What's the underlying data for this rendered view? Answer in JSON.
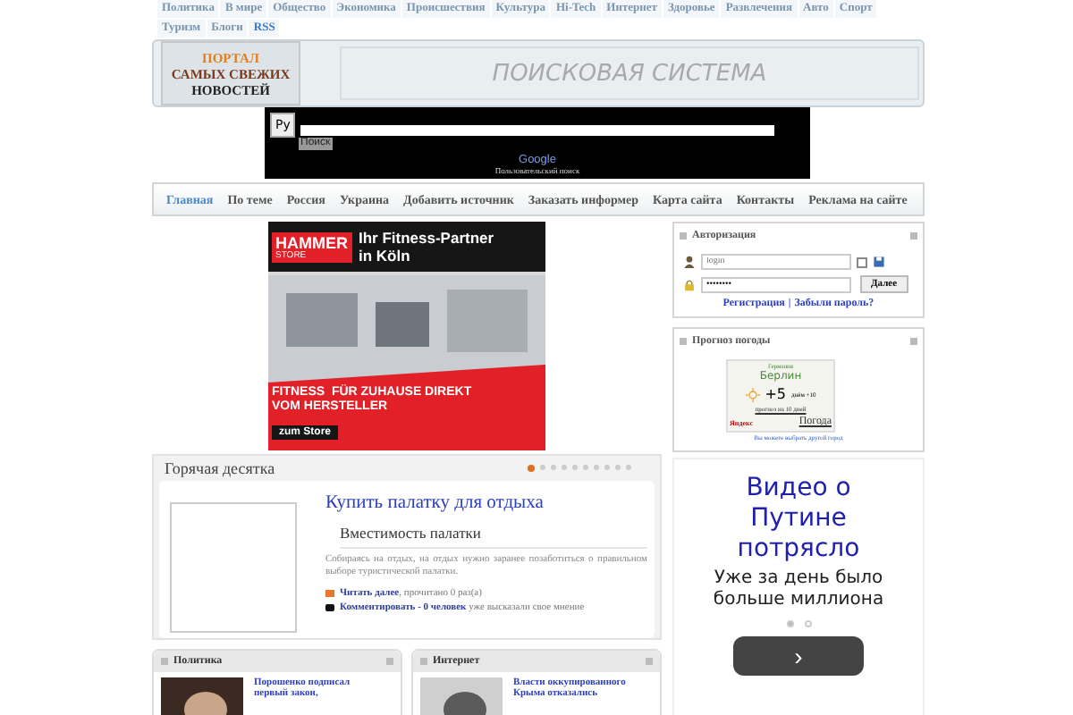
{
  "top_nav": [
    {
      "label": "Политика",
      "kind": "plain"
    },
    {
      "label": "В мире",
      "kind": "plain"
    },
    {
      "label": "Общество",
      "kind": "plain"
    },
    {
      "label": "Экономика",
      "kind": "plain"
    },
    {
      "label": "Происшествия",
      "kind": "plain"
    },
    {
      "label": "Культура",
      "kind": "plain"
    },
    {
      "label": "Hi-Tech",
      "kind": "plain"
    },
    {
      "label": "Интернет",
      "kind": "plain"
    },
    {
      "label": "Здоровье",
      "kind": "plain"
    },
    {
      "label": "Развлечения",
      "kind": "plain"
    },
    {
      "label": "Авто",
      "kind": "plain"
    },
    {
      "label": "Спорт",
      "kind": "plain"
    },
    {
      "label": "Туризм",
      "kind": "plain"
    },
    {
      "label": "Блоги",
      "kind": "plain"
    },
    {
      "label": "RSS",
      "kind": "rss"
    }
  ],
  "logo": [
    "ПОРТАЛ",
    "САМЫХ СВЕЖИХ",
    "НОВОСТЕЙ"
  ],
  "banner": "ПОИСКОВАЯ СИСТЕМА",
  "search": {
    "lang": "Ру",
    "button": "Поиск",
    "brand": "Google",
    "caption": "Пользовательский поиск"
  },
  "main_nav": [
    {
      "label": "Главная",
      "selected": true
    },
    {
      "label": "По теме",
      "selected": false
    },
    {
      "label": "Россия",
      "selected": false
    },
    {
      "label": "Украина",
      "selected": false
    },
    {
      "label": "Добавить источник",
      "selected": false
    },
    {
      "label": "Заказать информер",
      "selected": false
    },
    {
      "label": "Карта сайта",
      "selected": false
    },
    {
      "label": "Контакты",
      "selected": false
    },
    {
      "label": "Реклама на сайте",
      "selected": false
    }
  ],
  "ad": {
    "brand": "HAMMER",
    "brand_sub": "STORE",
    "headline": "Ihr Fitness-Partner in Köln",
    "slogan": "FITNESS  FÜR ZUHAUSE DIREKT VOM HERSTELLER",
    "button": "zum Store"
  },
  "hot": {
    "title": "Горячая десятка",
    "dots": [
      {
        "selected": true
      },
      {
        "selected": false
      },
      {
        "selected": false
      },
      {
        "selected": false
      },
      {
        "selected": false
      },
      {
        "selected": false
      },
      {
        "selected": false
      },
      {
        "selected": false
      },
      {
        "selected": false
      },
      {
        "selected": false
      }
    ],
    "article": {
      "title": "Купить палатку для отдыха",
      "subtitle": "Вместимость палатки",
      "text": "Собираясь на отдых, на отдых нужно заранее позаботиться о правильном выборе туристической палатки.",
      "read_more": "Читать далее",
      "read_count": ", прочитано 0 раз(а)",
      "comment": "Комментировать - 0 человек",
      "comment_tail": "уже высказали свое мнение"
    }
  },
  "sections": [
    {
      "title": "Политика",
      "headline": "Порошенко подписал первый закон,"
    },
    {
      "title": "Интернет",
      "headline": "Власти оккупированного Крыма отказались"
    }
  ],
  "auth": {
    "title": "Авторизация",
    "login_placeholder": "login",
    "password": "••••••••",
    "remember": false,
    "button": "Далее",
    "register": "Регистрация",
    "separator": "|",
    "forgot": "Забыли пароль?"
  },
  "weather": {
    "title": "Прогноз погоды",
    "country": "Германия",
    "city": "Берлин",
    "temp": "+5",
    "day": "днём +10",
    "forecast": "прогноз на 10 дней",
    "brand": "Яндекс",
    "link": "Погода",
    "change": "Вы можете выбрать другой город"
  },
  "ad2": {
    "title": "Видео о Путине потрясло",
    "text": "Уже за день было больше миллиона",
    "dots": [
      {
        "selected": true
      },
      {
        "selected": false
      }
    ],
    "button": "›"
  }
}
